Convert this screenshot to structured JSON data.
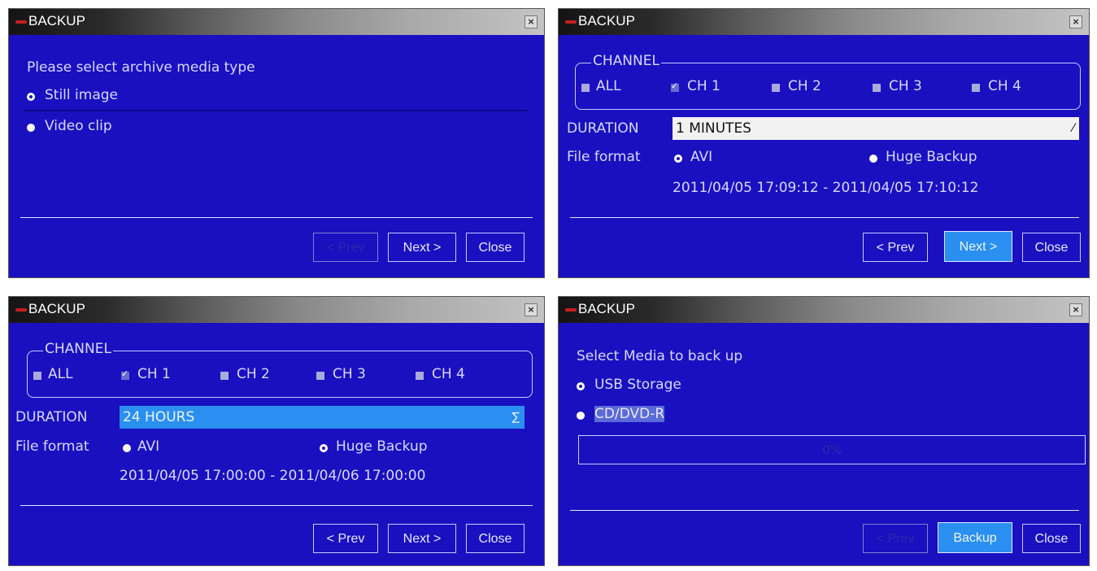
{
  "panels": [
    {
      "title": "BACKUP",
      "prompt": "Please select archive media type",
      "options": [
        {
          "label": "Still image",
          "selected": true
        },
        {
          "label": "Video clip",
          "selected": false
        }
      ],
      "buttons": {
        "prev": "< Prev",
        "next": "Next >",
        "close": "Close"
      }
    },
    {
      "title": "BACKUP",
      "channel_title": "CHANNEL",
      "channels": [
        {
          "label": "ALL",
          "checked": false
        },
        {
          "label": "CH 1",
          "checked": true
        },
        {
          "label": "CH 2",
          "checked": false
        },
        {
          "label": "CH 3",
          "checked": false
        },
        {
          "label": "CH 4",
          "checked": false
        }
      ],
      "duration_label": "DURATION",
      "duration_value": "1 MINUTES",
      "file_format_label": "File format",
      "formats": [
        {
          "label": "AVI",
          "selected": true
        },
        {
          "label": "Huge Backup",
          "selected": false
        }
      ],
      "time_range": "2011/04/05 17:09:12 - 2011/04/05 17:10:12",
      "buttons": {
        "prev": "< Prev",
        "next": "Next >",
        "close": "Close"
      }
    },
    {
      "title": "BACKUP",
      "channel_title": "CHANNEL",
      "channels": [
        {
          "label": "ALL",
          "checked": false
        },
        {
          "label": "CH 1",
          "checked": true
        },
        {
          "label": "CH 2",
          "checked": false
        },
        {
          "label": "CH 3",
          "checked": false
        },
        {
          "label": "CH 4",
          "checked": false
        }
      ],
      "duration_label": "DURATION",
      "duration_value": "24 HOURS",
      "file_format_label": "File format",
      "formats": [
        {
          "label": "AVI",
          "selected": false
        },
        {
          "label": "Huge Backup",
          "selected": true
        }
      ],
      "time_range": "2011/04/05 17:00:00 - 2011/04/06 17:00:00",
      "buttons": {
        "prev": "< Prev",
        "next": "Next >",
        "close": "Close"
      }
    },
    {
      "title": "BACKUP",
      "prompt": "Select Media to back up",
      "options": [
        {
          "label": "USB Storage",
          "selected": true
        },
        {
          "label": "CD/DVD-R",
          "selected": false
        }
      ],
      "progress": "0%",
      "buttons": {
        "prev": "< Prev",
        "backup": "Backup",
        "close": "Close"
      }
    }
  ],
  "colors": {
    "panel_bg": "#1a10c0",
    "highlight": "#2a8ff0",
    "close_icon": "close-icon"
  }
}
